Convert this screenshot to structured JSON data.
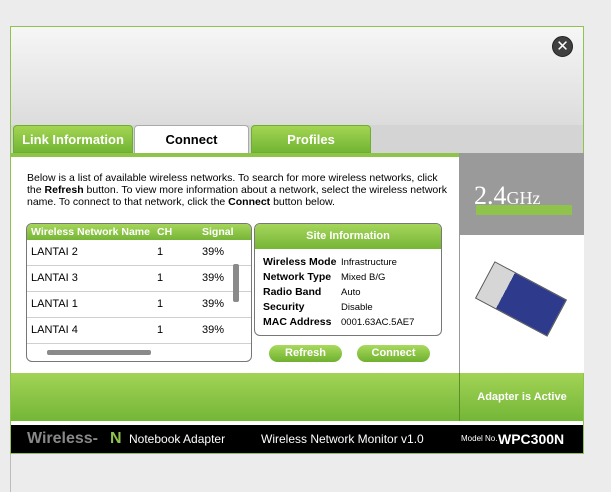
{
  "window": {
    "close_glyph": "✕"
  },
  "tabs": [
    {
      "label": "Link Information",
      "active": false
    },
    {
      "label": "Connect",
      "active": true
    },
    {
      "label": "Profiles",
      "active": false
    }
  ],
  "description": {
    "p1": "Below is a list of available wireless networks. To search for more wireless networks, click the ",
    "refresh_word": "Refresh",
    "p2": " button. To view more information about a network, select the wireless network name. To connect to that network, click the ",
    "connect_word": "Connect",
    "p3": " button below."
  },
  "network_table": {
    "headers": [
      "Wireless Network Name",
      "CH",
      "Signal"
    ],
    "rows": [
      {
        "name": "LANTAI 2",
        "ch": "1",
        "signal": "39%"
      },
      {
        "name": "LANTAI 3",
        "ch": "1",
        "signal": "39%"
      },
      {
        "name": "LANTAI 1",
        "ch": "1",
        "signal": "39%"
      },
      {
        "name": "LANTAI 4",
        "ch": "1",
        "signal": "39%"
      }
    ]
  },
  "site_info": {
    "title": "Site Information",
    "rows": [
      {
        "label": "Wireless Mode",
        "value": "Infrastructure"
      },
      {
        "label": "Network Type",
        "value": "Mixed B/G"
      },
      {
        "label": "Radio Band",
        "value": "Auto"
      },
      {
        "label": "Security",
        "value": "Disable"
      },
      {
        "label": "MAC Address",
        "value": "0001.63AC.5AE7"
      }
    ]
  },
  "buttons": {
    "refresh": "Refresh",
    "connect": "Connect"
  },
  "right_panel": {
    "ghz_number": "2.4",
    "ghz_unit": "GHz",
    "status": "Adapter is Active"
  },
  "footer": {
    "brand_part1": "Wireless-",
    "brand_part2": "N",
    "product": "Notebook Adapter",
    "monitor": "Wireless Network Monitor  v1.0",
    "model_label": "Model No.",
    "model": "WPC300N"
  },
  "colors": {
    "accent_green": "#8fc34b",
    "footer_bg": "#000000"
  }
}
